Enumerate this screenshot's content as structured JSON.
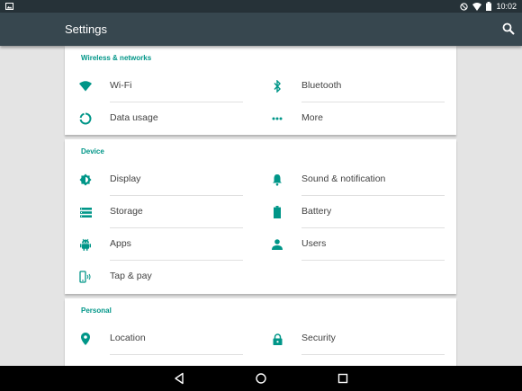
{
  "status": {
    "time": "10:02"
  },
  "appbar": {
    "title": "Settings"
  },
  "sections": {
    "wireless": {
      "header": "Wireless & networks",
      "items": {
        "wifi": "Wi-Fi",
        "bluetooth": "Bluetooth",
        "data": "Data usage",
        "more": "More"
      }
    },
    "device": {
      "header": "Device",
      "items": {
        "display": "Display",
        "sound": "Sound & notification",
        "storage": "Storage",
        "battery": "Battery",
        "apps": "Apps",
        "users": "Users",
        "tap": "Tap & pay"
      }
    },
    "personal": {
      "header": "Personal",
      "items": {
        "location": "Location",
        "security": "Security"
      }
    }
  },
  "colors": {
    "accent": "#009688",
    "appbar": "#37474f",
    "statusbar": "#263238"
  },
  "icons": {
    "wifi": "wifi-icon",
    "bluetooth": "bluetooth-icon",
    "data": "data-usage-icon",
    "more": "more-icon",
    "display": "display-icon",
    "sound": "bell-icon",
    "storage": "storage-icon",
    "battery": "battery-icon",
    "apps": "android-icon",
    "users": "user-icon",
    "tap": "tap-pay-icon",
    "location": "location-icon",
    "security": "lock-icon"
  }
}
